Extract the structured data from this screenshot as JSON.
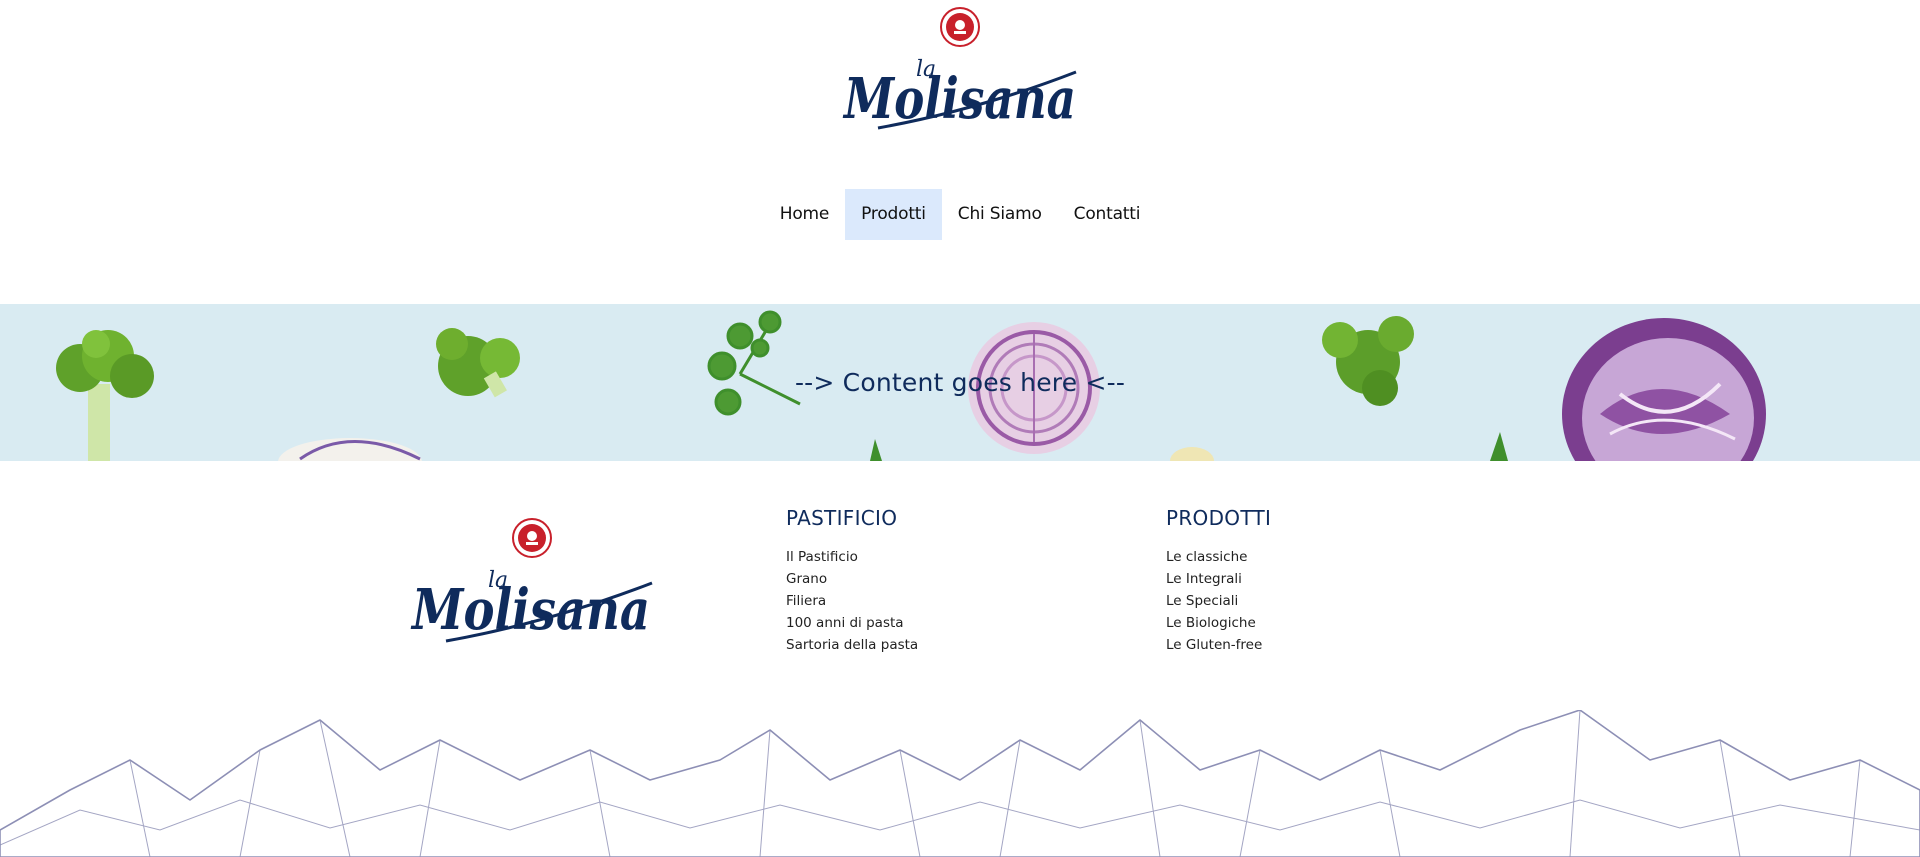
{
  "brand": {
    "logo_text_small": "la",
    "logo_text_main": "Molisana",
    "logo_color": "#0f2b5c",
    "seal_color": "#c8202b"
  },
  "nav": {
    "items": [
      {
        "label": "Home",
        "active": false
      },
      {
        "label": "Prodotti",
        "active": true
      },
      {
        "label": "Chi Siamo",
        "active": false
      },
      {
        "label": "Contatti",
        "active": false
      }
    ],
    "active_color": "#dbe9fc"
  },
  "banner": {
    "text": "--> Content goes here <--",
    "background": "#d9ebf2"
  },
  "footer": {
    "columns": [
      {
        "title": "PASTIFICIO",
        "links": [
          "Il Pastificio",
          "Grano",
          "Filiera",
          "100 anni di pasta",
          "Sartoria della pasta"
        ]
      },
      {
        "title": "PRODOTTI",
        "links": [
          "Le classiche",
          "Le Integrali",
          "Le Speciali",
          "Le Biologiche",
          "Le Gluten-free"
        ]
      }
    ]
  }
}
